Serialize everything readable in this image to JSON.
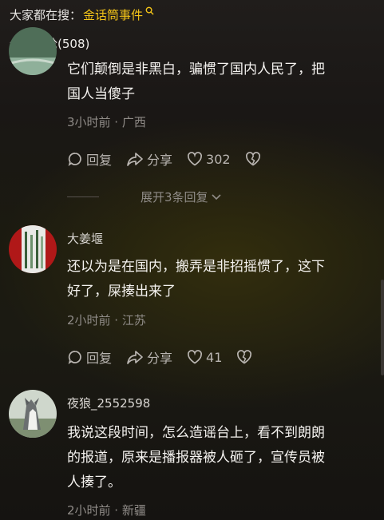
{
  "top_search": {
    "label": "大家都在搜：",
    "keyword": "金话筒事件"
  },
  "comment_count": "全部评论(508)",
  "comments": [
    {
      "text_line1": "它们颠倒是非黑白，骗惯了国内人民了，把",
      "text_line2": "国人当傻子",
      "meta": "3小时前 · 广西",
      "reply": "回复",
      "share": "分享",
      "likes": "302",
      "expand": "展开3条回复"
    },
    {
      "nickname": "大姜堰",
      "text_line1": "还以为是在国内，搬弄是非招摇惯了，这下",
      "text_line2": "好了，屎揍出来了",
      "meta": "2小时前 · 江苏",
      "reply": "回复",
      "share": "分享",
      "likes": "41"
    },
    {
      "nickname": "夜狼_2552598",
      "text_line1": "我说这段时间，怎么造谣台上，看不到朗朗",
      "text_line2": "的报道，原来是播报器被人砸了，宣传员被",
      "text_line3": "人揍了。",
      "meta": "2小时前 · 新疆"
    }
  ],
  "icons": [
    "search-icon",
    "reply-icon",
    "share-icon",
    "heart-icon",
    "broken-heart-icon",
    "chevron-down-icon"
  ],
  "colors": {
    "keyword": "#f5c518",
    "text": "#f4f2ef",
    "meta": "#8f8b87"
  }
}
